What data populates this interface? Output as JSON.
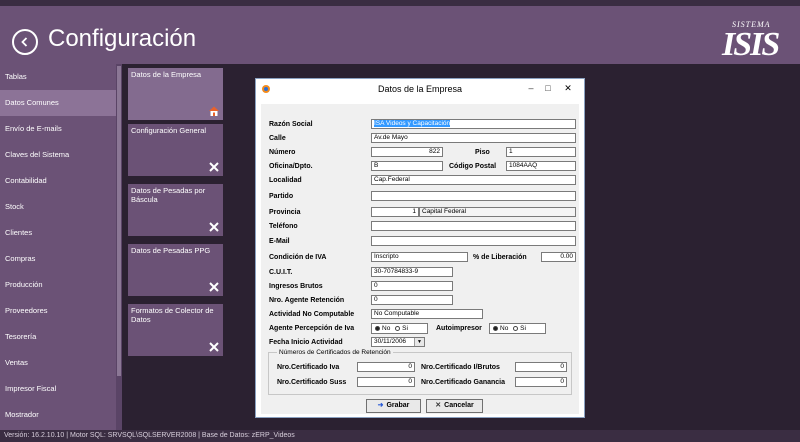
{
  "header": {
    "title": "Configuración",
    "logo_top": "SISTEMA",
    "logo_main": "ISIS"
  },
  "sidebar": {
    "items": [
      {
        "label": "Tablas"
      },
      {
        "label": "Datos Comunes"
      },
      {
        "label": "Envío de E-mails"
      },
      {
        "label": "Claves del Sistema"
      },
      {
        "label": "Contabilidad"
      },
      {
        "label": "Stock"
      },
      {
        "label": "Clientes"
      },
      {
        "label": "Compras"
      },
      {
        "label": "Producción"
      },
      {
        "label": "Proveedores"
      },
      {
        "label": "Tesorería"
      },
      {
        "label": "Ventas"
      },
      {
        "label": "Impresor Fiscal"
      },
      {
        "label": "Mostrador"
      }
    ],
    "active_index": 1
  },
  "cards": [
    {
      "label": "Datos de la Empresa",
      "icon": "house-icon"
    },
    {
      "label": "Configuración General",
      "icon": "tools-icon"
    },
    {
      "label": "Datos de Pesadas por Báscula",
      "icon": "tools-icon"
    },
    {
      "label": "Datos de Pesadas PPG",
      "icon": "tools-icon"
    },
    {
      "label": "Formatos de Colector de Datos",
      "icon": "tools-icon"
    }
  ],
  "dialog": {
    "title": "Datos de la Empresa",
    "labels": {
      "razon_social": "Razón Social",
      "calle": "Calle",
      "numero": "Número",
      "piso": "Piso",
      "oficina": "Oficina/Dpto.",
      "codigo_postal": "Código Postal",
      "localidad": "Localidad",
      "partido": "Partido",
      "provincia": "Provincia",
      "telefono": "Teléfono",
      "email": "E-Mail",
      "condicion_iva": "Condición de IVA",
      "pct_liberacion": "% de Liberación",
      "cuit": "C.U.I.T.",
      "ingresos_brutos": "Ingresos Brutos",
      "agente_retencion": "Nro. Agente Retención",
      "actividad_no_computable": "Actividad No Computable",
      "agente_percepcion": "Agente Percepción de Iva",
      "autoimpresor": "Autoimpresor",
      "fecha_inicio": "Fecha Inicio Actividad"
    },
    "values": {
      "razon_social": "ISA Videos y Capacitación",
      "calle": "Av.de Mayo",
      "numero": "822",
      "piso": "1",
      "oficina": "B",
      "codigo_postal": "1084AAQ",
      "localidad": "Cap.Federal",
      "partido": "",
      "provincia_codigo": "1",
      "provincia_nombre": "Capital Federal",
      "telefono": "",
      "email": "",
      "condicion_iva": "Inscripto",
      "pct_liberacion": "0.00",
      "cuit": "30-70784833-9",
      "ingresos_brutos": "0",
      "agente_retencion": "0",
      "actividad_no_computable": "No Computable",
      "fecha_inicio": "30/11/2006"
    },
    "radio": {
      "no": "No",
      "si": "Si",
      "agente_percepcion_selected": "No",
      "autoimpresor_selected": "No"
    },
    "certificados": {
      "title": "Números de Certificados de Retención",
      "iva_label": "Nro.Certificado Iva",
      "iva_value": "0",
      "suss_label": "Nro.Certificado Suss",
      "suss_value": "0",
      "ibrutos_label": "Nro.Certificado I/Brutos",
      "ibrutos_value": "0",
      "ganancia_label": "Nro.Certificado Ganancia",
      "ganancia_value": "0"
    },
    "buttons": {
      "grabar": "Grabar",
      "cancelar": "Cancelar"
    }
  },
  "statusbar": {
    "text": "Versión: 16.2.10.10 | Motor SQL: SRVSQL\\SQLSERVER2008 | Base de Datos: zERP_Videos"
  }
}
